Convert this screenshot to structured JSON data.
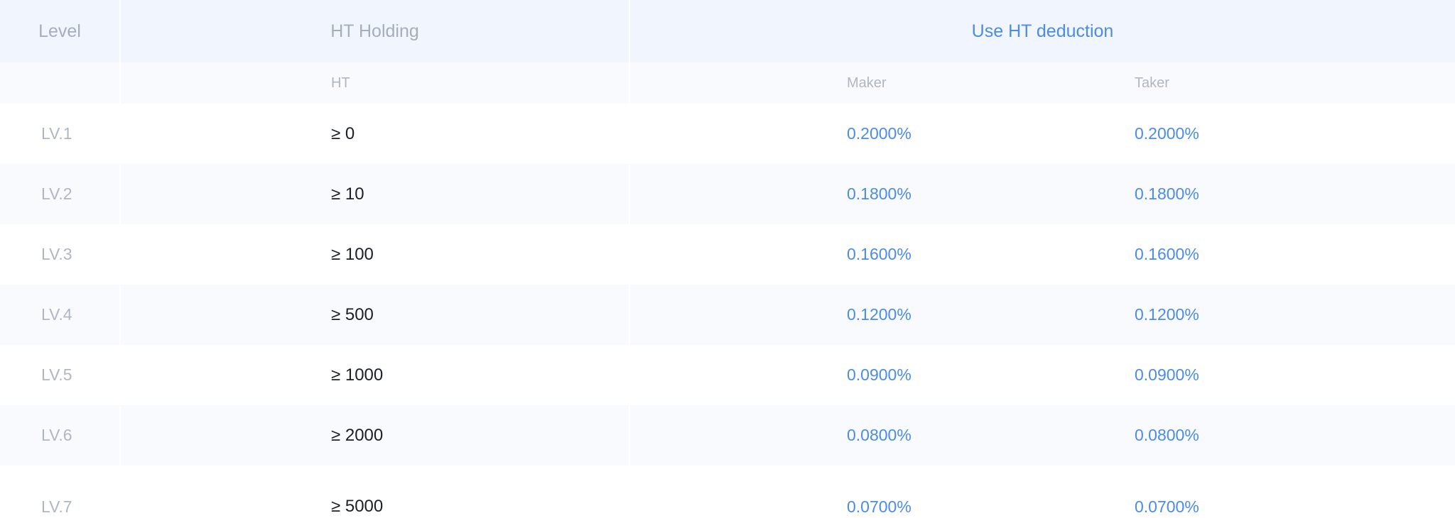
{
  "header": {
    "level": "Level",
    "holding": "HT Holding",
    "deduction": "Use HT deduction"
  },
  "subheader": {
    "unit": "HT",
    "maker": "Maker",
    "taker": "Taker"
  },
  "rows": [
    {
      "level": "LV.1",
      "holding": "≥ 0",
      "maker": "0.2000%",
      "taker": "0.2000%"
    },
    {
      "level": "LV.2",
      "holding": "≥ 10",
      "maker": "0.1800%",
      "taker": "0.1800%"
    },
    {
      "level": "LV.3",
      "holding": "≥ 100",
      "maker": "0.1600%",
      "taker": "0.1600%"
    },
    {
      "level": "LV.4",
      "holding": "≥ 500",
      "maker": "0.1200%",
      "taker": "0.1200%"
    },
    {
      "level": "LV.5",
      "holding": "≥ 1000",
      "maker": "0.0900%",
      "taker": "0.0900%"
    },
    {
      "level": "LV.6",
      "holding": "≥ 2000",
      "maker": "0.0800%",
      "taker": "0.0800%"
    },
    {
      "level": "LV.7",
      "holding": "≥ 5000",
      "maker": "0.0700%",
      "taker": "0.0700%"
    }
  ],
  "colors": {
    "accent": "#4a8ce8",
    "header_bg": "#f1f5fd",
    "stripe_bg": "#f8fafe",
    "muted_text": "#b0b6c2",
    "value_text": "#1b1f27"
  }
}
